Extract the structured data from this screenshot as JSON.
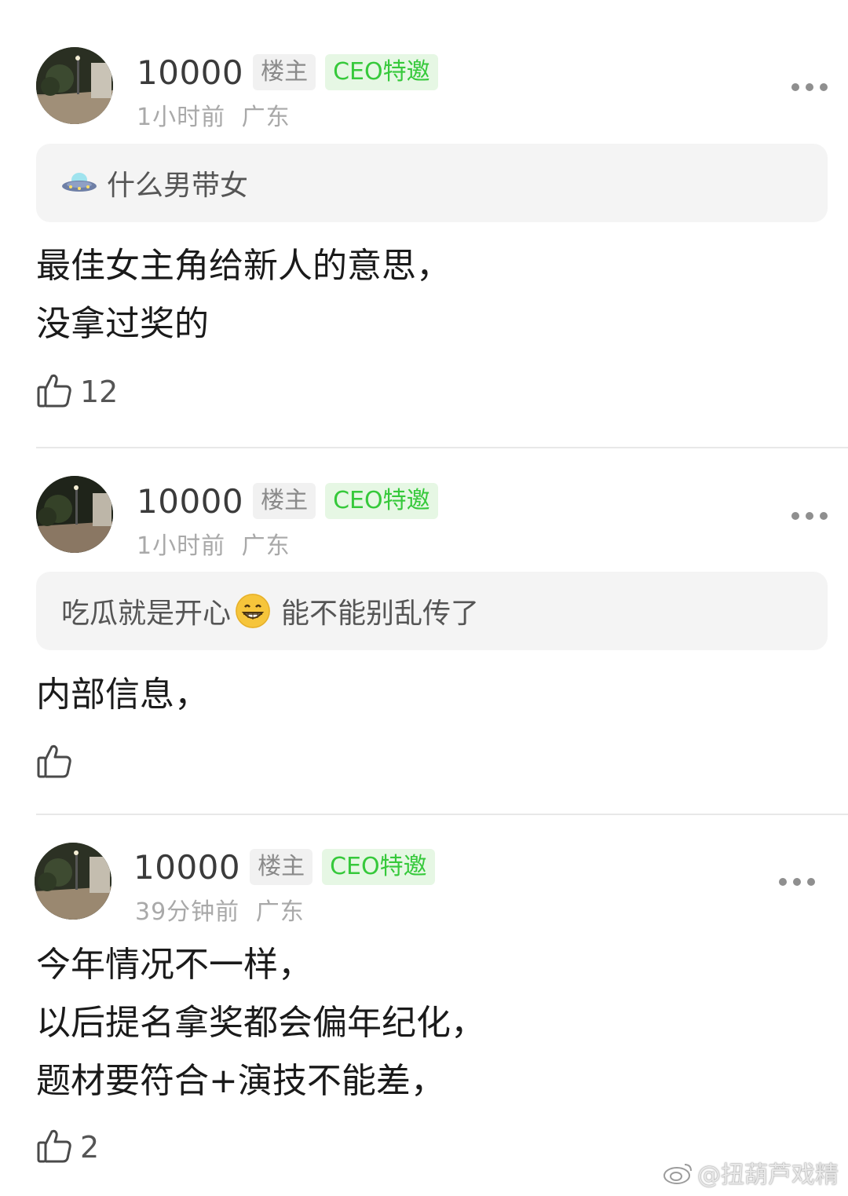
{
  "posts": [
    {
      "username": "10000",
      "badge_host": "楼主",
      "badge_ceo": "CEO特邀",
      "time": "1小时前",
      "location": "广东",
      "quote": {
        "icon": "ufo-icon",
        "text": "什么男带女"
      },
      "lines": [
        "最佳女主角给新人的意思，",
        "没拿过奖的"
      ],
      "likes": "12"
    },
    {
      "username": "10000",
      "badge_host": "楼主",
      "badge_ceo": "CEO特邀",
      "time": "1小时前",
      "location": "广东",
      "quote": {
        "text_before": "吃瓜就是开心",
        "emoji": "grinning-face-icon",
        "text_after": "能不能别乱传了"
      },
      "lines": [
        "内部信息，"
      ],
      "likes": ""
    },
    {
      "username": "10000",
      "badge_host": "楼主",
      "badge_ceo": "CEO特邀",
      "time": "39分钟前",
      "location": "广东",
      "lines": [
        "今年情况不一样，",
        "以后提名拿奖都会偏年纪化，",
        "题材要符合+演技不能差，"
      ],
      "likes": "2"
    }
  ],
  "watermark": "@扭葫芦戏精",
  "colors": {
    "ceo_badge_text": "#36c93b",
    "ceo_badge_bg": "#e6f7e4",
    "meta_gray": "#a9a9a9"
  }
}
